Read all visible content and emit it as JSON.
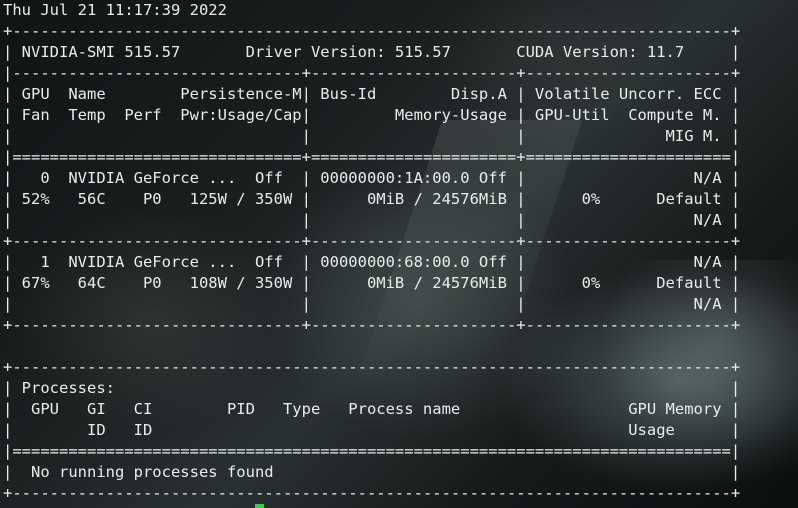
{
  "terminal": {
    "timestamp": "Thu Jul 21 11:17:39 2022",
    "lines": [
      "+-----------------------------------------------------------------------------+",
      "| NVIDIA-SMI 515.57       Driver Version: 515.57       CUDA Version: 11.7     |",
      "|-------------------------------+----------------------+----------------------+",
      "| GPU  Name        Persistence-M| Bus-Id        Disp.A | Volatile Uncorr. ECC |",
      "| Fan  Temp  Perf  Pwr:Usage/Cap|         Memory-Usage | GPU-Util  Compute M. |",
      "|                               |                      |               MIG M. |",
      "|===============================+======================+======================|",
      "|   0  NVIDIA GeForce ...  Off  | 00000000:1A:00.0 Off |                  N/A |",
      "| 52%   56C    P0   125W / 350W |      0MiB / 24576MiB |      0%      Default |",
      "|                               |                      |                  N/A |",
      "+-------------------------------+----------------------+----------------------+",
      "|   1  NVIDIA GeForce ...  Off  | 00000000:68:00.0 Off |                  N/A |",
      "| 67%   64C    P0   108W / 350W |      0MiB / 24576MiB |      0%      Default |",
      "|                               |                      |                  N/A |",
      "+-------------------------------+----------------------+----------------------+",
      "",
      "+-----------------------------------------------------------------------------+",
      "| Processes:                                                                  |",
      "|  GPU   GI   CI        PID   Type   Process name                  GPU Memory |",
      "|        ID   ID                                                   Usage      |",
      "|=============================================================================|",
      "|  No running processes found                                                 |",
      "+-----------------------------------------------------------------------------+"
    ]
  }
}
